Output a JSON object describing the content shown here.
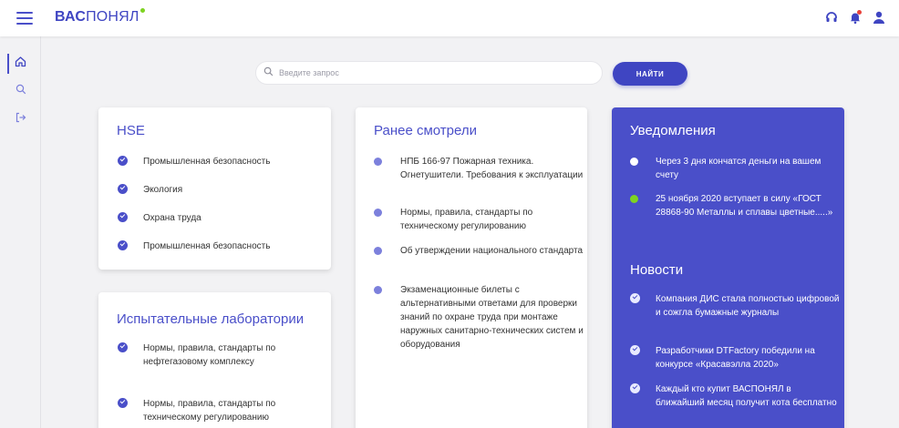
{
  "header": {
    "logo_part1": "ВАС",
    "logo_part2": "ПОНЯЛ",
    "accent_color": "#3f45c2",
    "logo_dot_color": "#7ed321",
    "icons": [
      "menu-icon",
      "headset-icon",
      "bell-icon",
      "user-icon"
    ]
  },
  "sidebar": {
    "items": [
      {
        "name": "home",
        "icon": "home-icon",
        "active": true
      },
      {
        "name": "search",
        "icon": "search-icon",
        "active": false
      },
      {
        "name": "logout",
        "icon": "logout-icon",
        "active": false
      }
    ]
  },
  "search": {
    "placeholder": "Введите запрос",
    "value": "",
    "button_label": "НАЙТИ"
  },
  "hse": {
    "title": "HSE",
    "items": [
      "Промышленная безопасность",
      "Экология",
      "Охрана труда",
      "Промышленная безопасность"
    ]
  },
  "labs": {
    "title": "Испытательные лаборатории",
    "items": [
      "Нормы, правила, стандарты по нефтегазовому комплексу",
      "Нормы, правила, стандарты по техническому регулированию"
    ]
  },
  "recent": {
    "title": "Ранее смотрели",
    "items": [
      "НПБ 166-97 Пожарная техника. Огнетушители. Требования к эксплуатации",
      "Нормы, правила, стандарты по техническому регулированию",
      "Об утверждении национального стандарта",
      "Экзаменационные билеты с альтернативными ответами для проверки знаний по охране труда при монтаже наружных санитарно-технических систем и оборудования"
    ]
  },
  "notifications": {
    "title": "Уведомления",
    "items": [
      {
        "text": "Через 3 дня кончатся деньги на вашем счету",
        "color": "#ffffff"
      },
      {
        "text": "25 ноября 2020 вступает в силу «ГОСТ 28868-90 Металлы и сплавы цветные.....»",
        "color": "#7ed321"
      }
    ]
  },
  "news": {
    "title": "Новости",
    "items": [
      "Компания ДИС стала полностью цифровой и сожгла бумажные журналы",
      "Разработчики DTFactory победили на конкурсе «Красавэлла 2020»",
      "Каждый кто купит ВАСПОНЯЛ в ближайший месяц получит кота бесплатно"
    ]
  }
}
